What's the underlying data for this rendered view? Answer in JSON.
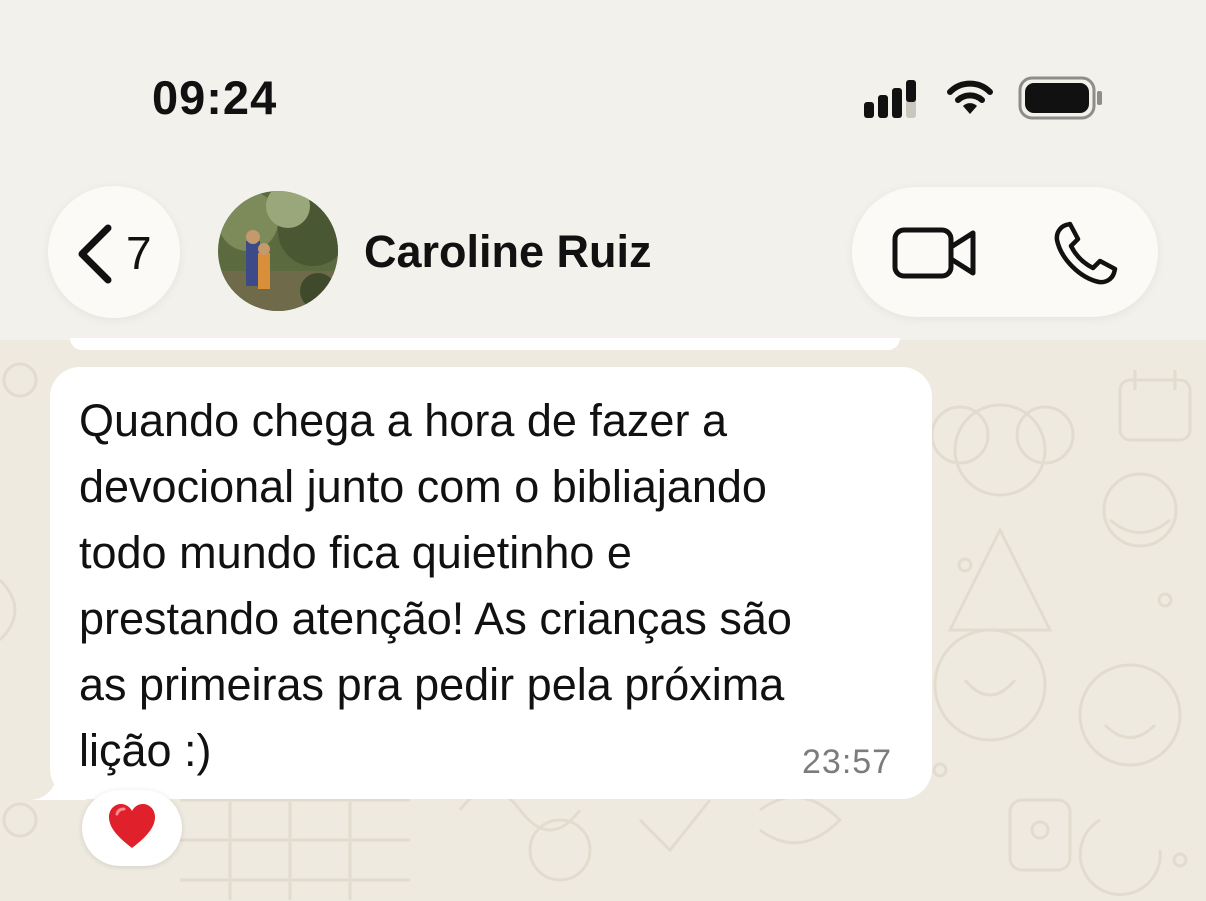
{
  "status_bar": {
    "time": "09:24",
    "icons": [
      "signal-icon",
      "wifi-icon",
      "battery-icon"
    ]
  },
  "header": {
    "back_count": "7",
    "contact_name": "Caroline Ruiz",
    "actions": [
      "video-call-icon",
      "phone-call-icon"
    ]
  },
  "message": {
    "text": "Quando chega a hora de fazer a\ndevocional junto com o bibliajando\ntodo mundo fica quietinho e\nprestando atenção! As crianças são\nas primeiras pra pedir pela próxima\nlição :)",
    "time": "23:57",
    "reaction": "heart-emoji"
  },
  "colors": {
    "background": "#f3f1ec",
    "wallpaper": "#efeadf",
    "bubble": "#ffffff",
    "timestamp": "#7c7c7c",
    "heart": "#e0202a"
  }
}
